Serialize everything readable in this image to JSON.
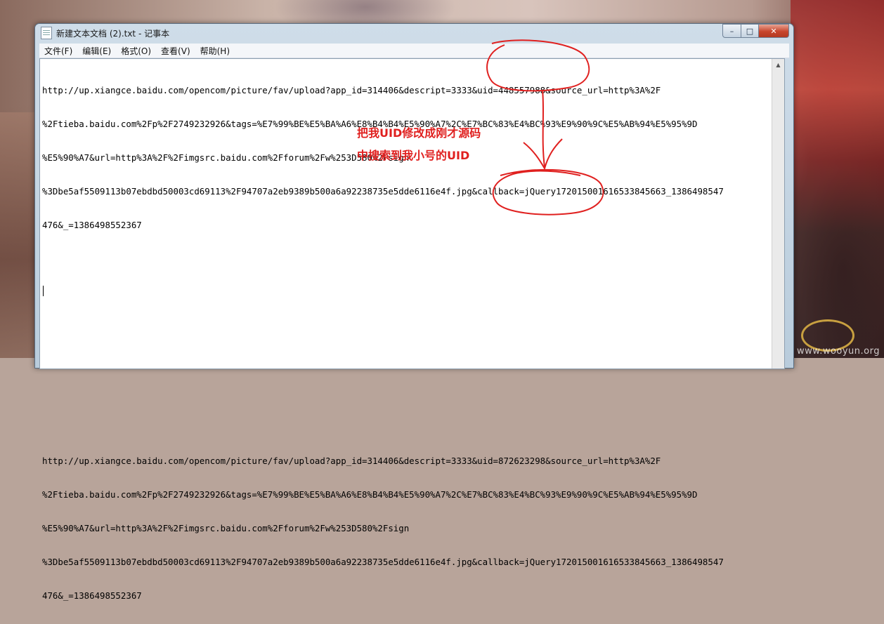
{
  "window": {
    "title": "新建文本文档 (2).txt - 记事本",
    "controls": {
      "minimize": "–",
      "maximize": "□",
      "close": "✕"
    }
  },
  "menu": [
    {
      "label": "文件(F)"
    },
    {
      "label": "编辑(E)"
    },
    {
      "label": "格式(O)"
    },
    {
      "label": "查看(V)"
    },
    {
      "label": "帮助(H)"
    }
  ],
  "document": {
    "lines": [
      "http://up.xiangce.baidu.com/opencom/picture/fav/upload?app_id=314406&descript=3333&uid=448557988&source_url=http%3A%2F",
      "%2Ftieba.baidu.com%2Fp%2F2749232926&tags=%E7%99%BE%E5%BA%A6%E8%B4%B4%E5%90%A7%2C%E7%BC%83%E4%BC%93%E9%90%9C%E5%AB%94%E5%95%9D",
      "%E5%90%A7&url=http%3A%2F%2Fimgsrc.baidu.com%2Fforum%2Fw%253D580%2Fsign",
      "%3Dbe5af5509113b07ebdbd50003cd69113%2F94707a2eb9389b500a6a92238735e5dde6116e4f.jpg&callback=jQuery17201500161653384566​3_1386498547",
      "476&_=1386498552367",
      "",
      "",
      "",
      "",
      "",
      "",
      "http://up.xiangce.baidu.com/opencom/picture/fav/upload?app_id=314406&descript=3333&uid=872623298&source_url=http%3A%2F",
      "%2Ftieba.baidu.com%2Fp%2F2749232926&tags=%E7%99%BE%E5%BA%A6%E8%B4%B4%E5%90%A7%2C%E7%BC%83%E4%BC%93%E9%90%9C%E5%AB%94%E5%95%9D",
      "%E5%90%A7&url=http%3A%2F%2Fimgsrc.baidu.com%2Fforum%2Fw%253D580%2Fsign",
      "%3Dbe5af5509113b07ebdbd50003cd69113%2F94707a2eb9389b500a6a92238735e5dde6116e4f.jpg&callback=jQuery17201500161653384566​3_1386498547",
      "476&_=1386498552367"
    ]
  },
  "annotation": {
    "line1": "把我UID修改成刚才源码",
    "line2": "中搜索到我小号的UID",
    "color": "#e0201f"
  },
  "watermark": "www.wooyun.org"
}
